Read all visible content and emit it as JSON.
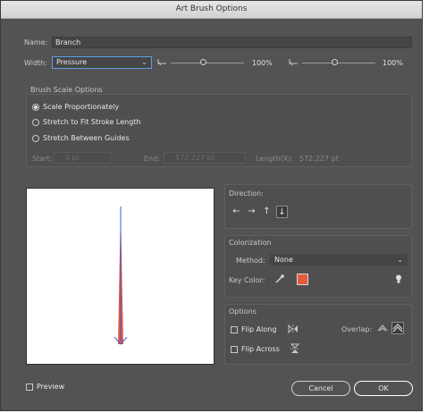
{
  "title": "Art Brush Options",
  "name": {
    "label": "Name:",
    "value": "Branch"
  },
  "width": {
    "label": "Width:",
    "selected": "Pressure",
    "min_percent": "100%",
    "max_percent": "100%",
    "min_level": 0.45,
    "max_level": 0.45
  },
  "brush_scale": {
    "heading": "Brush Scale Options",
    "options": [
      {
        "label": "Scale Proportionately",
        "selected": true
      },
      {
        "label": "Stretch to Fit Stroke Length",
        "selected": false
      },
      {
        "label": "Stretch Between Guides",
        "selected": false
      }
    ],
    "start_label": "Start:",
    "start_value": "0 pt",
    "end_label": "End:",
    "end_value": "572.227 pt",
    "length_label": "Length(X):",
    "length_value": "572.227 pt"
  },
  "direction": {
    "heading": "Direction:",
    "buttons": [
      "←",
      "→",
      "↑",
      "↓"
    ],
    "selected_index": 3
  },
  "colorization": {
    "heading": "Colorization",
    "method_label": "Method:",
    "method_value": "None",
    "key_color_label": "Key Color:",
    "key_color": "#e35b3e"
  },
  "options": {
    "heading": "Options",
    "flip_along": "Flip Along",
    "flip_across": "Flip Across",
    "overlap_label": "Overlap:",
    "flip_along_checked": false,
    "flip_across_checked": false
  },
  "preview": {
    "label": "Preview",
    "checked": false,
    "stroke_color": "#e35b3e",
    "guide_color": "#3b5bdb"
  },
  "buttons": {
    "cancel": "Cancel",
    "ok": "OK"
  }
}
